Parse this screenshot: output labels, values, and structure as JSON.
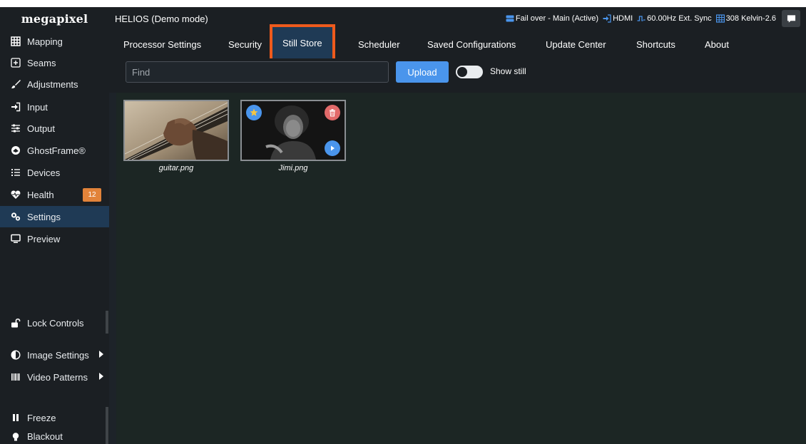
{
  "app": {
    "logo": "megapixel",
    "title": "HELIOS (Demo mode)"
  },
  "status": {
    "failover": "Fail over - Main (Active)",
    "input": "HDMI",
    "sync": "60.00Hz Ext. Sync",
    "color_temp": "308 Kelvin-2.6"
  },
  "sidebar": {
    "items": [
      {
        "label": "Mapping",
        "icon": "grid-icon"
      },
      {
        "label": "Seams",
        "icon": "plus-square-icon"
      },
      {
        "label": "Adjustments",
        "icon": "brush-icon"
      },
      {
        "label": "Input",
        "icon": "sign-in-icon"
      },
      {
        "label": "Output",
        "icon": "sliders-icon"
      },
      {
        "label": "GhostFrame®",
        "icon": "ghostframe-icon"
      },
      {
        "label": "Devices",
        "icon": "list-icon"
      },
      {
        "label": "Health",
        "icon": "heartbeat-icon",
        "badge": "12"
      },
      {
        "label": "Settings",
        "icon": "cogs-icon",
        "active": true
      },
      {
        "label": "Preview",
        "icon": "monitor-icon"
      }
    ],
    "lock_controls": "Lock Controls",
    "image_settings": "Image Settings",
    "video_patterns": "Video Patterns",
    "freeze": "Freeze",
    "blackout": "Blackout"
  },
  "tabs": [
    {
      "label": "Processor Settings"
    },
    {
      "label": "Security"
    },
    {
      "label": "Still Store",
      "active": true
    },
    {
      "label": "Scheduler"
    },
    {
      "label": "Saved Configurations"
    },
    {
      "label": "Update Center"
    },
    {
      "label": "Shortcuts"
    },
    {
      "label": "About"
    }
  ],
  "toolbar": {
    "find_placeholder": "Find",
    "upload_label": "Upload",
    "show_still_label": "Show still",
    "show_still_on": false
  },
  "stills": [
    {
      "name": "guitar.png"
    },
    {
      "name": "Jimi.png",
      "starred": true
    }
  ],
  "colors": {
    "accent": "#4a95ec",
    "highlight": "#ee5a1c",
    "badge": "#e2833a",
    "delete": "#e26a6a",
    "star": "#f5c542"
  }
}
